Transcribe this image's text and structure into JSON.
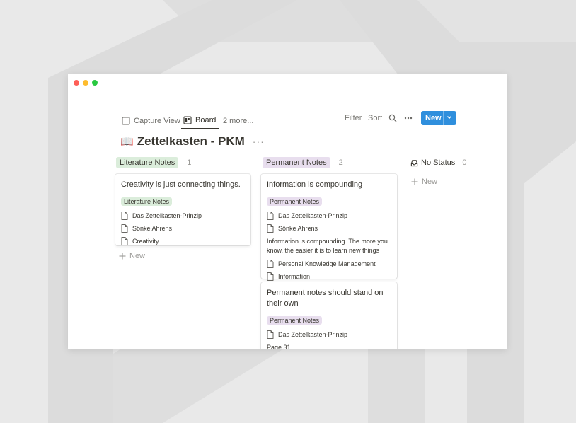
{
  "window": {
    "view_tabs": [
      {
        "label": "Capture View",
        "icon": "table-icon"
      },
      {
        "label": "Board",
        "icon": "board-icon"
      },
      {
        "label": "2 more..."
      }
    ],
    "toolbar": {
      "filter": "Filter",
      "sort": "Sort",
      "new": "New"
    },
    "page": {
      "emoji": "📖",
      "title": "Zettelkasten - PKM",
      "more": "···"
    }
  },
  "board": {
    "columns": [
      {
        "name": "Literature Notes",
        "count": "1",
        "color": "#dbeddb",
        "cards": [
          {
            "title": "Creativity is just connecting things.",
            "tag": "Literature Notes",
            "props": [
              "Das Zettelkasten-Prinzip",
              "Sönke Ahrens",
              "Creativity"
            ]
          }
        ],
        "add_label": "New"
      },
      {
        "name": "Permanent Notes",
        "count": "2",
        "color": "#e8deee",
        "cards": [
          {
            "title": "Information is compounding",
            "tag": "Permanent Notes",
            "props": [
              "Das Zettelkasten-Prinzip",
              "Sönke Ahrens"
            ],
            "text": "Information is compounding. The more you know, the easier it is to learn new things",
            "props2": [
              "Personal Knowledge Management",
              "Information"
            ]
          },
          {
            "title": "Permanent notes should stand on their own",
            "tag": "Permanent Notes",
            "props": [
              "Das Zettelkasten-Prinzip"
            ],
            "text": "Page 31."
          }
        ]
      },
      {
        "name": "No Status",
        "count": "0",
        "icon": "inbox-icon",
        "add_label": "New"
      }
    ]
  }
}
